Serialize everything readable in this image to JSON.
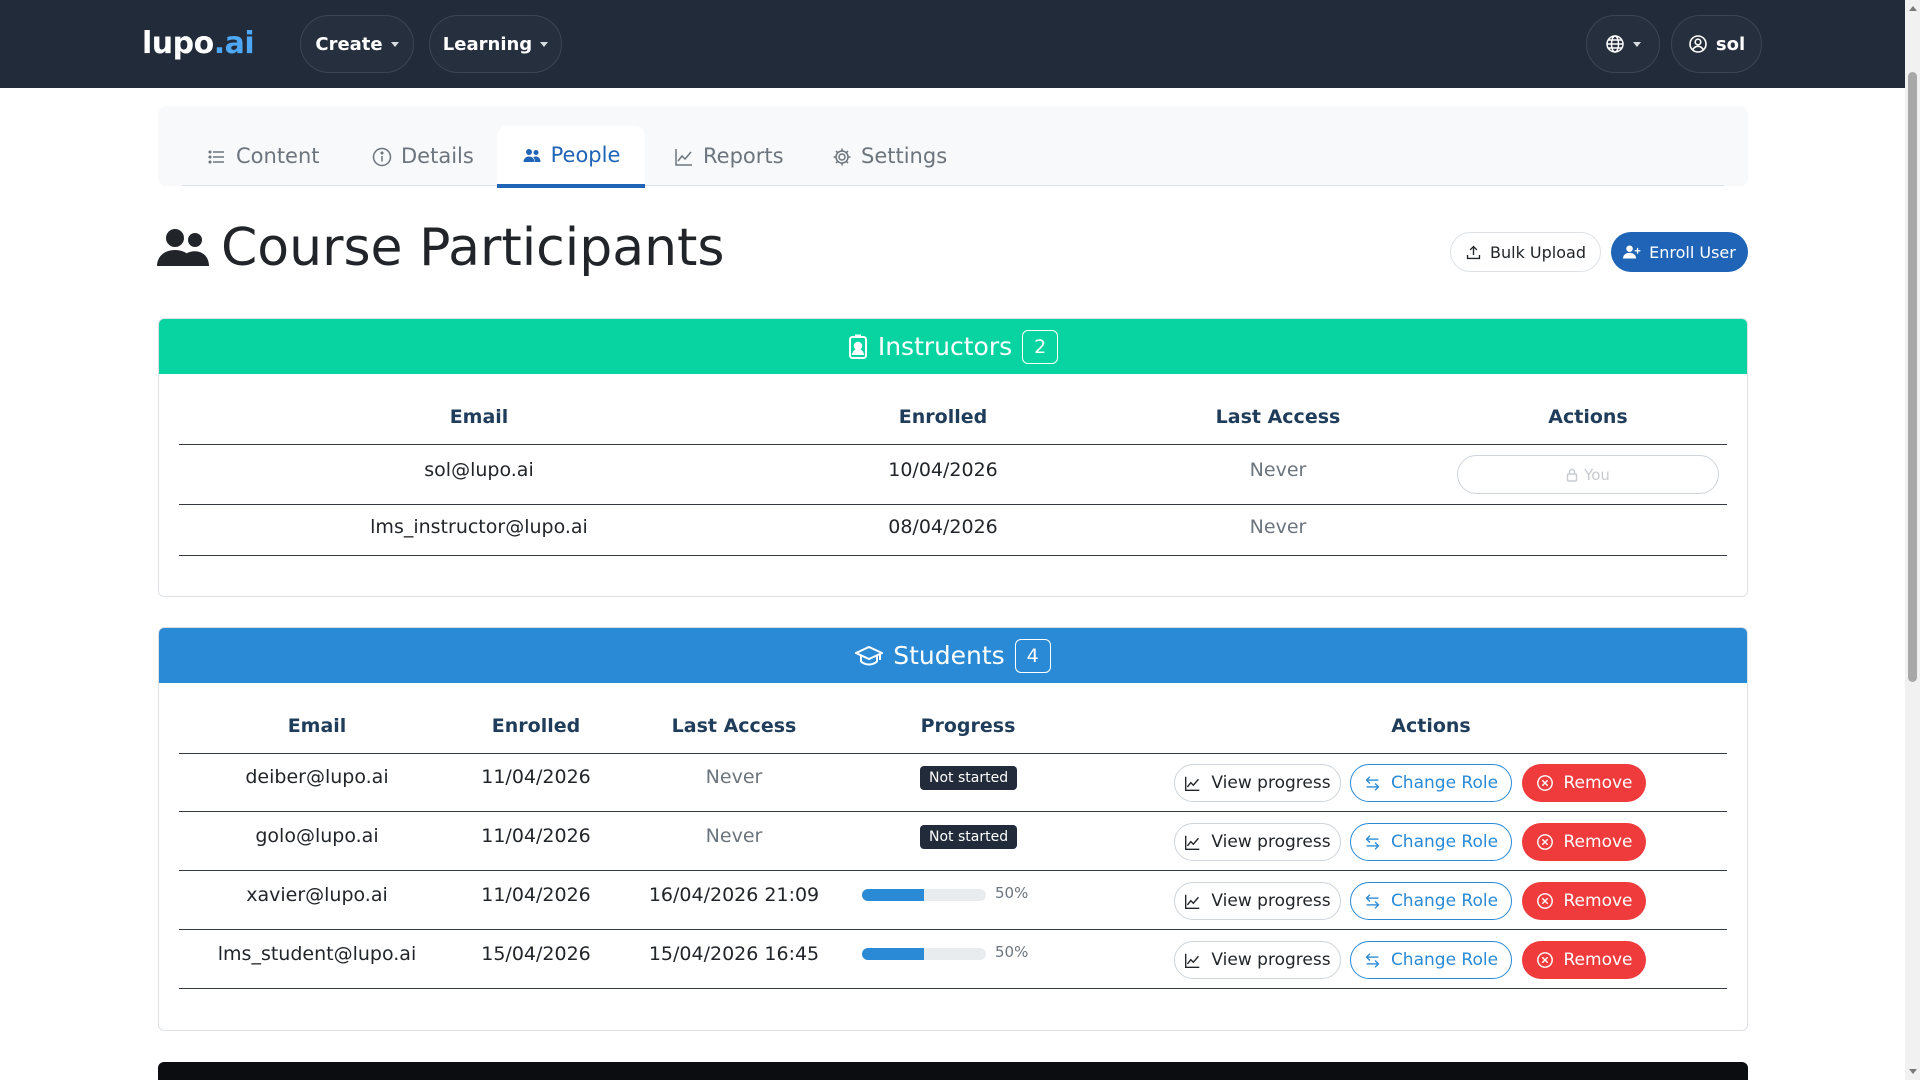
{
  "navbar": {
    "brand_main": "lupo",
    "brand_accent": ".ai",
    "menu_create": "Create",
    "menu_learning": "Learning",
    "user_name": "sol",
    "icons": [
      "globe-icon",
      "user-circle-icon"
    ]
  },
  "tabs": [
    {
      "label": "Content",
      "icon": "list-icon",
      "active": false
    },
    {
      "label": "Details",
      "icon": "info-icon",
      "active": false
    },
    {
      "label": "People",
      "icon": "people-icon",
      "active": true
    },
    {
      "label": "Reports",
      "icon": "chart-icon",
      "active": false
    },
    {
      "label": "Settings",
      "icon": "gear-icon",
      "active": false
    }
  ],
  "page": {
    "title": "Course Participants",
    "bulk_upload_label": "Bulk Upload",
    "enroll_user_label": "Enroll User"
  },
  "instructors": {
    "title": "Instructors",
    "count": "2",
    "columns": [
      "Email",
      "Enrolled",
      "Last Access",
      "Actions"
    ],
    "rows": [
      {
        "email": "sol@lupo.ai",
        "enrolled": "10/04/2026",
        "last_access": "Never",
        "action": "You"
      },
      {
        "email": "lms_instructor@lupo.ai",
        "enrolled": "08/04/2026",
        "last_access": "Never",
        "action": ""
      }
    ]
  },
  "students": {
    "title": "Students",
    "count": "4",
    "columns": [
      "Email",
      "Enrolled",
      "Last Access",
      "Progress",
      "Actions"
    ],
    "actions": {
      "view": "View progress",
      "role": "Change Role",
      "remove": "Remove"
    },
    "rows": [
      {
        "email": "deiber@lupo.ai",
        "enrolled": "11/04/2026",
        "last_access": "Never",
        "progress_text": "Not started",
        "progress": null
      },
      {
        "email": "golo@lupo.ai",
        "enrolled": "11/04/2026",
        "last_access": "Never",
        "progress_text": "Not started",
        "progress": null
      },
      {
        "email": "xavier@lupo.ai",
        "enrolled": "11/04/2026",
        "last_access": "16/04/2026 21:09",
        "progress_text": "50%",
        "progress": 0.5
      },
      {
        "email": "lms_student@lupo.ai",
        "enrolled": "15/04/2026",
        "last_access": "15/04/2026 16:45",
        "progress_text": "50%",
        "progress": 0.5
      }
    ]
  },
  "colors": {
    "navbar": "#222b3a",
    "primary": "#1f64b7",
    "instructors_header": "#07d4a1",
    "students_header": "#2a8ad6",
    "danger": "#ef3b3b"
  }
}
